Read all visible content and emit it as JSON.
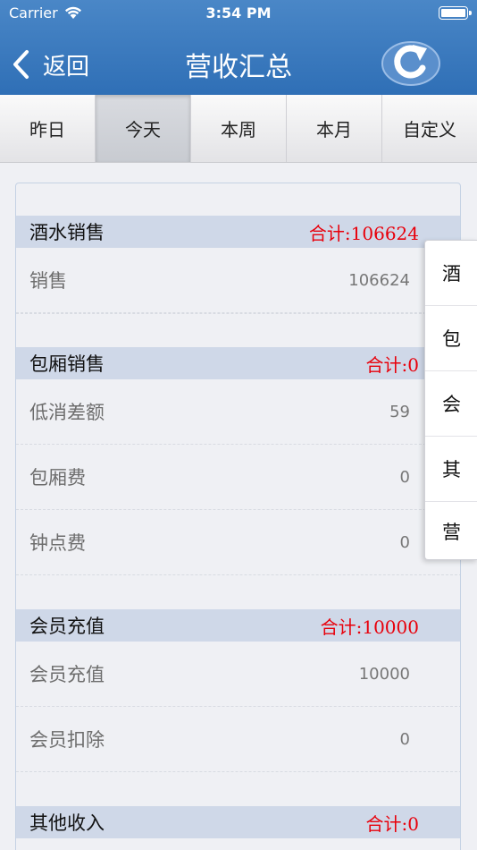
{
  "status": {
    "carrier": "Carrier",
    "time": "3:54 PM"
  },
  "nav": {
    "back_label": "返回",
    "title": "营收汇总"
  },
  "tabs": [
    {
      "label": "昨日"
    },
    {
      "label": "今天"
    },
    {
      "label": "本周"
    },
    {
      "label": "本月"
    },
    {
      "label": "自定义"
    }
  ],
  "active_tab": "今天",
  "sections": [
    {
      "name": "酒水销售",
      "total": "合计:106624",
      "rows": [
        {
          "label": "销售",
          "value": "106624"
        }
      ]
    },
    {
      "name": "包厢销售",
      "total": "合计:0",
      "rows": [
        {
          "label": "低消差额",
          "value": "59"
        },
        {
          "label": "包厢费",
          "value": "0"
        },
        {
          "label": "钟点费",
          "value": "0"
        }
      ]
    },
    {
      "name": "会员充值",
      "total": "合计:10000",
      "rows": [
        {
          "label": "会员充值",
          "value": "10000"
        },
        {
          "label": "会员扣除",
          "value": "0"
        }
      ]
    },
    {
      "name": "其他收入",
      "total": "合计:0",
      "rows": []
    }
  ],
  "index": [
    "酒",
    "包",
    "会",
    "其",
    "营"
  ],
  "colors": {
    "nav_blue": "#3a78bd",
    "section_header": "#cfd8e8",
    "total_red": "#e8000b"
  }
}
